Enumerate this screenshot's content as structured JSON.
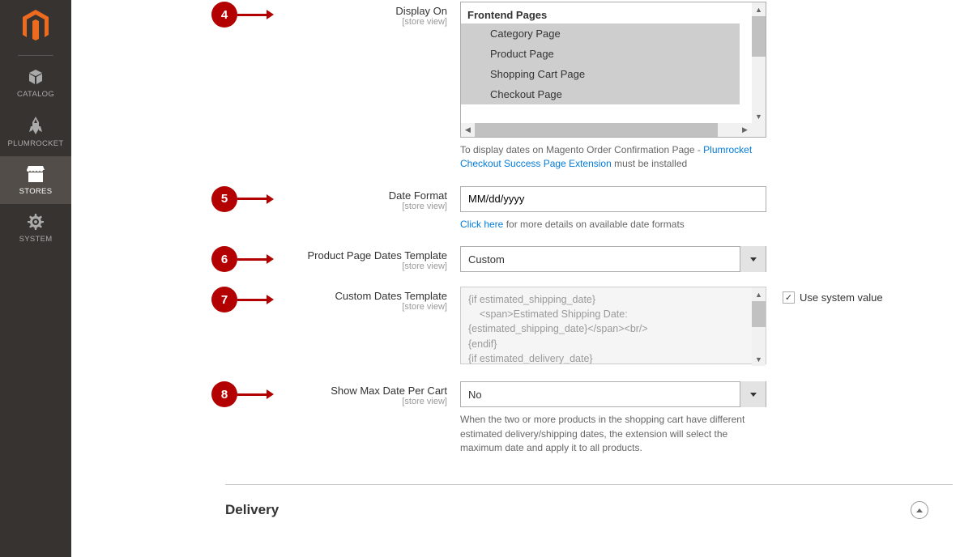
{
  "sidebar": {
    "items": [
      {
        "label": "CATALOG",
        "icon": "cube"
      },
      {
        "label": "PLUMROCKET",
        "icon": "rocket"
      },
      {
        "label": "STORES",
        "icon": "store",
        "active": true
      },
      {
        "label": "SYSTEM",
        "icon": "gear"
      }
    ]
  },
  "badges": {
    "b4": "4",
    "b5": "5",
    "b6": "6",
    "b7": "7",
    "b8": "8"
  },
  "fields": {
    "display_on": {
      "label": "Display On",
      "scope": "[store view]",
      "optgroup": "Frontend Pages",
      "options": [
        "Category Page",
        "Product Page",
        "Shopping Cart Page",
        "Checkout Page"
      ],
      "note_pre": "To display dates on Magento Order Confirmation Page - ",
      "note_link": "Plumrocket Checkout Success Page Extension",
      "note_post": " must be installed"
    },
    "date_format": {
      "label": "Date Format",
      "scope": "[store view]",
      "value": "MM/dd/yyyy",
      "note_link": "Click here",
      "note_post": " for more details on available date formats"
    },
    "product_template": {
      "label": "Product Page Dates Template",
      "scope": "[store view]",
      "value": "Custom"
    },
    "custom_template": {
      "label": "Custom Dates Template",
      "scope": "[store view]",
      "value": "{if estimated_shipping_date}\n    <span>Estimated Shipping Date: {estimated_shipping_date}</span><br/>\n{endif}\n{if estimated_delivery_date}\n    <span>Estimated Delivery Date:",
      "use_system": "Use system value"
    },
    "show_max": {
      "label": "Show Max Date Per Cart",
      "scope": "[store view]",
      "value": "No",
      "note": "When the two or more products in the shopping cart have different estimated delivery/shipping dates, the extension will select the maximum date and apply it to all products."
    }
  },
  "section": {
    "delivery": "Delivery"
  }
}
